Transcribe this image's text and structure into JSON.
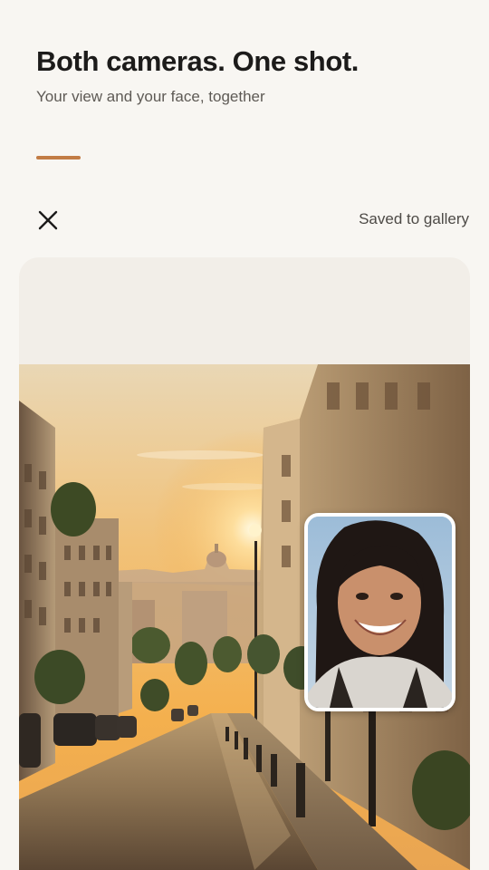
{
  "header": {
    "title": "Both cameras. One shot.",
    "subtitle": "Your view and your face, together"
  },
  "toolbar": {
    "close_icon": "close-icon",
    "status": "Saved to gallery"
  },
  "colors": {
    "accent": "#c27c45",
    "background": "#f8f6f2",
    "card": "#f2eee8"
  },
  "photo": {
    "main_scene": "sunset-city-street-photo",
    "inset": "selfie-photo"
  }
}
